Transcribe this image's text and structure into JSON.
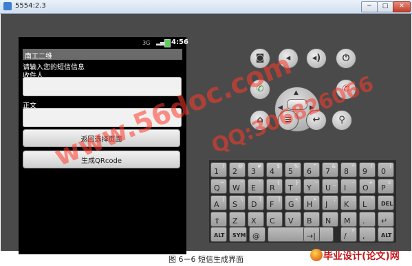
{
  "window": {
    "title": "5554:2.3",
    "controls": {
      "minimize": "─",
      "maximize": "□",
      "close": "✕"
    }
  },
  "status_bar": {
    "time": "4:56",
    "signal": "3G"
  },
  "app": {
    "title": "南工二维",
    "prompt": "请输入您的短信信息",
    "recipient_label": "收件人",
    "recipient_value": "",
    "body_label": "正文",
    "body_value": "",
    "back_button": "返回选择页面",
    "generate_button": "生成QRcode"
  },
  "hardware_buttons": {
    "camera": "◙",
    "volume_down": "◂",
    "volume_up": "◂)",
    "power": "⏻",
    "call": "✆",
    "end_call": "✆",
    "home": "⌂",
    "menu": "≡",
    "back": "↩",
    "search": "⚲"
  },
  "dpad_arrows": {
    "up": "▲",
    "down": "▼",
    "left": "◀",
    "right": "▶"
  },
  "keyboard": {
    "row1": [
      {
        "main": "1",
        "shift": "!"
      },
      {
        "main": "2",
        "shift": "@"
      },
      {
        "main": "3",
        "shift": "#"
      },
      {
        "main": "4",
        "shift": "$"
      },
      {
        "main": "5",
        "shift": "%"
      },
      {
        "main": "6",
        "shift": "^"
      },
      {
        "main": "7",
        "shift": "&"
      },
      {
        "main": "8",
        "shift": "*"
      },
      {
        "main": "9",
        "shift": "("
      },
      {
        "main": "0",
        "shift": ")"
      }
    ],
    "row2": [
      {
        "main": "Q",
        "shift": "~"
      },
      {
        "main": "W",
        "shift": "\""
      },
      {
        "main": "E",
        "shift": "`"
      },
      {
        "main": "R",
        "shift": "{"
      },
      {
        "main": "T",
        "shift": "}"
      },
      {
        "main": "Y",
        "shift": "-"
      },
      {
        "main": "U",
        "shift": "_"
      },
      {
        "main": "I",
        "shift": "-"
      },
      {
        "main": "O",
        "shift": "+"
      },
      {
        "main": "P",
        "shift": "="
      }
    ],
    "row3": [
      {
        "main": "A",
        "shift": "|"
      },
      {
        "main": "S",
        "shift": "\\"
      },
      {
        "main": "D",
        "shift": "["
      },
      {
        "main": "F",
        "shift": "]"
      },
      {
        "main": "G",
        "shift": "<"
      },
      {
        "main": "H",
        "shift": ">"
      },
      {
        "main": "J",
        "shift": ";"
      },
      {
        "main": "K",
        "shift": ":"
      },
      {
        "main": "L",
        "shift": "'"
      },
      {
        "main": "DEL",
        "shift": ""
      }
    ],
    "row4": [
      {
        "main": "⇧",
        "shift": ""
      },
      {
        "main": "Z",
        "shift": ""
      },
      {
        "main": "X",
        "shift": ""
      },
      {
        "main": "C",
        "shift": ""
      },
      {
        "main": "V",
        "shift": ""
      },
      {
        "main": "B",
        "shift": ""
      },
      {
        "main": "N",
        "shift": ""
      },
      {
        "main": "M",
        "shift": ""
      },
      {
        "main": ".",
        "shift": ""
      },
      {
        "main": "↵",
        "shift": ""
      }
    ],
    "row5": [
      {
        "main": "ALT",
        "shift": ""
      },
      {
        "main": "SYM",
        "shift": ""
      },
      {
        "main": "@",
        "shift": ""
      },
      {
        "main": "",
        "shift": ""
      },
      {
        "main": "→|",
        "shift": ""
      },
      {
        "main": "/",
        "shift": "?"
      },
      {
        "main": ",",
        "shift": ""
      },
      {
        "main": "ALT",
        "shift": ""
      }
    ]
  },
  "watermarks": {
    "site": "www.56doc.com",
    "qq": "QQ:306826066"
  },
  "branding": {
    "url": "56DOC.COM",
    "name": "毕业设计(论文)网"
  },
  "caption": "图 6－6 短信生成界面",
  "colors": {
    "emulator_body": "#4a4a4a",
    "keyboard": "#2b2b2b",
    "watermark": "#ff3a2a"
  }
}
